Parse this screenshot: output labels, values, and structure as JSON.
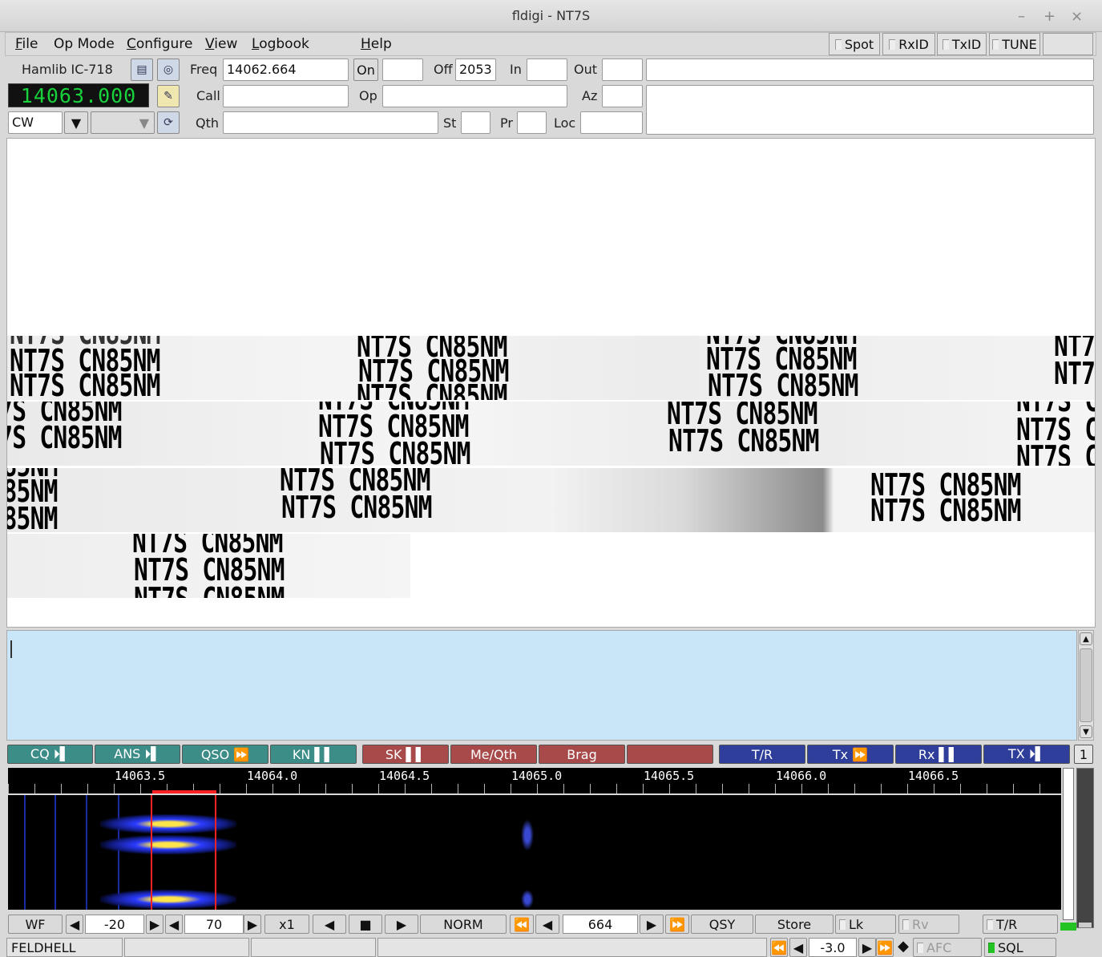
{
  "window": {
    "title": "fldigi - NT7S",
    "controls": [
      "–",
      "+",
      "×"
    ]
  },
  "menu": [
    {
      "label": "File",
      "mn": "F",
      "rest": "ile"
    },
    {
      "label": "Op Mode",
      "mn": "",
      "rest": "Op Mode"
    },
    {
      "label": "Configure",
      "mn": "C",
      "rest": "onfigure"
    },
    {
      "label": "View",
      "mn": "V",
      "rest": "iew"
    },
    {
      "label": "Logbook",
      "mn": "L",
      "rest": "ogbook"
    },
    {
      "label": "Help",
      "mn": "H",
      "rest": "elp"
    }
  ],
  "toggles": {
    "spot": "Spot",
    "rxid": "RxID",
    "txid": "TxID",
    "tune": "TUNE"
  },
  "rig": {
    "name": "Hamlib IC-718",
    "freq_display": "14063.000",
    "mode": "CW"
  },
  "log": {
    "freq_label": "Freq",
    "freq_value": "14062.664",
    "on_label": "On",
    "on_value": "",
    "off_label": "Off",
    "off_value": "2053",
    "in_label": "In",
    "out_label": "Out",
    "call_label": "Call",
    "op_label": "Op",
    "az_label": "Az",
    "qth_label": "Qth",
    "st_label": "St",
    "pr_label": "Pr",
    "loc_label": "Loc"
  },
  "rx_text": "NT7S CN85NM",
  "macros": [
    {
      "label": "CQ ⏵▌",
      "color": "#3c8c88"
    },
    {
      "label": "ANS ⏵▌",
      "color": "#3c8c88"
    },
    {
      "label": "QSO ⏩",
      "color": "#3c8c88"
    },
    {
      "label": "KN ▌▌",
      "color": "#3c8c88"
    },
    {
      "label": "SK ▌▌",
      "color": "#a84a4a"
    },
    {
      "label": "Me/Qth",
      "color": "#a84a4a"
    },
    {
      "label": "Brag",
      "color": "#a84a4a"
    },
    {
      "label": "",
      "color": "#a84a4a"
    },
    {
      "label": "T/R",
      "color": "#2e3e9a"
    },
    {
      "label": "Tx ⏩",
      "color": "#2e3e9a"
    },
    {
      "label": "Rx ▌▌",
      "color": "#2e3e9a"
    },
    {
      "label": "TX ⏵▌",
      "color": "#2e3e9a"
    }
  ],
  "macro_set": "1",
  "scale_ticks": [
    "14063.5",
    "14064.0",
    "14064.5",
    "14065.0",
    "14065.5",
    "14066.0",
    "14066.5"
  ],
  "controls": {
    "wf": "WF",
    "min": "-20",
    "range": "70",
    "zoom": "x1",
    "norm": "NORM",
    "carrier": "664",
    "qsy": "QSY",
    "store": "Store",
    "lk": "Lk",
    "rv": "Rv",
    "tr": "T/R",
    "squelch": "-3.0",
    "afc": "AFC",
    "sql": "SQL"
  },
  "status": {
    "mode": "FELDHELL"
  }
}
